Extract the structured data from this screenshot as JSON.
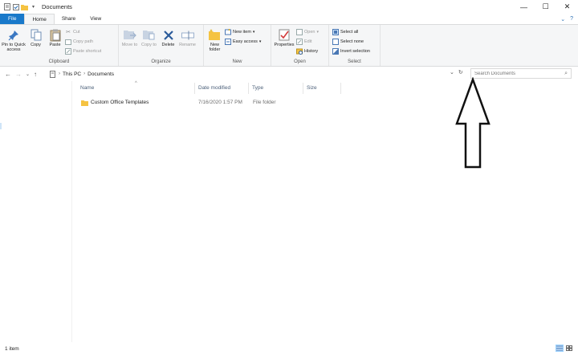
{
  "titlebar": {
    "title": "Documents",
    "qat_icons": [
      "properties-icon",
      "checkbox-icon",
      "folder-icon",
      "dropdown-caret-icon"
    ],
    "controls": {
      "minimize": "—",
      "maximize": "☐",
      "close": "✕"
    }
  },
  "tabs": [
    {
      "label": "File",
      "active": false,
      "file": true
    },
    {
      "label": "Home",
      "active": true,
      "file": false
    },
    {
      "label": "Share",
      "active": false,
      "file": false
    },
    {
      "label": "View",
      "active": false,
      "file": false
    }
  ],
  "tabs_right": {
    "expand": "⌄",
    "help": "?"
  },
  "ribbon": {
    "clipboard": {
      "label": "Clipboard",
      "pin": "Pin to Quick access",
      "copy": "Copy",
      "paste": "Paste",
      "cut": "Cut",
      "copy_path": "Copy path",
      "paste_shortcut": "Paste shortcut"
    },
    "organize": {
      "label": "Organize",
      "move_to": "Move to",
      "copy_to": "Copy to",
      "delete": "Delete",
      "rename": "Rename"
    },
    "new": {
      "label": "New",
      "new_folder": "New folder",
      "new_item": "New item",
      "easy_access": "Easy access"
    },
    "open": {
      "label": "Open",
      "properties": "Properties",
      "open": "Open",
      "edit": "Edit",
      "history": "History"
    },
    "select": {
      "label": "Select",
      "select_all": "Select all",
      "select_none": "Select none",
      "invert_selection": "Invert selection"
    }
  },
  "address": {
    "back": "←",
    "forward": "→",
    "recent": "⌄",
    "up": "↑",
    "crumbs": [
      "This PC",
      "Documents"
    ],
    "dropdown": "⌄",
    "refresh": "↻"
  },
  "search": {
    "placeholder": "Search Documents"
  },
  "columns": {
    "name": "Name",
    "date_modified": "Date modified",
    "type": "Type",
    "size": "Size"
  },
  "files": [
    {
      "name": "Custom Office Templates",
      "date_modified": "7/16/2020 1:57 PM",
      "type": "File folder",
      "size": ""
    }
  ],
  "status": {
    "item_count": "1 item"
  },
  "colors": {
    "accent": "#1979ca",
    "folder": "#f5c342",
    "selected_view": "#cce8ff"
  }
}
